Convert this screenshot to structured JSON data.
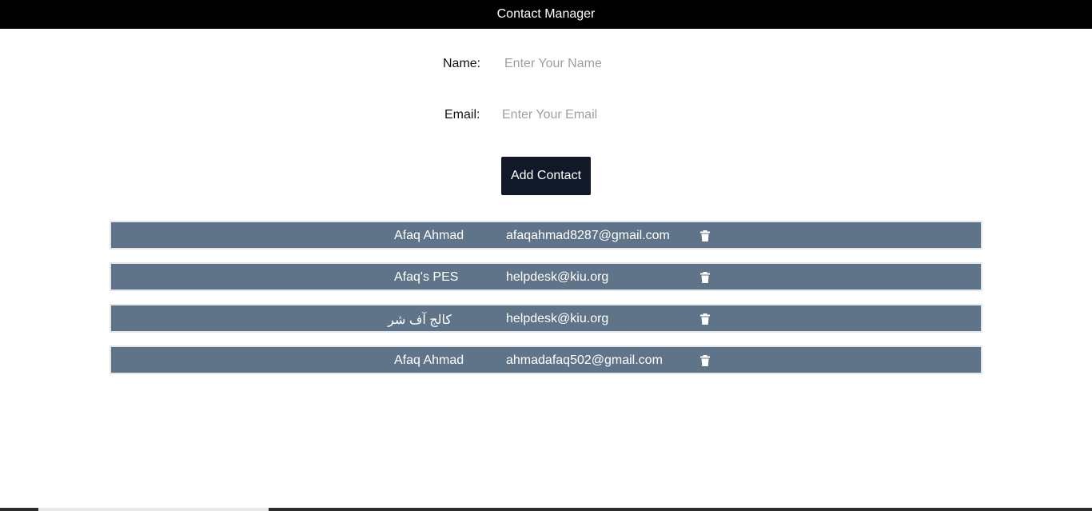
{
  "header": {
    "title": "Contact Manager"
  },
  "form": {
    "name_label": "Name:",
    "name_placeholder": "Enter Your Name",
    "name_value": "",
    "email_label": "Email:",
    "email_placeholder": "Enter Your Email",
    "email_value": "",
    "submit_label": "Add Contact"
  },
  "contacts": [
    {
      "name": "Afaq Ahmad",
      "email": "afaqahmad8287@gmail.com",
      "delete_icon": "trash-icon"
    },
    {
      "name": "Afaq's PES",
      "email": "helpdesk@kiu.org",
      "delete_icon": "trash-icon"
    },
    {
      "name": "کالج آف شر",
      "email": "helpdesk@kiu.org",
      "delete_icon": "trash-icon"
    },
    {
      "name": "Afaq Ahmad",
      "email": "ahmadafaq502@gmail.com",
      "delete_icon": "trash-icon"
    }
  ],
  "colors": {
    "header_bg": "#000000",
    "button_bg": "#111827",
    "row_bg": "#607489",
    "row_border": "#e2e6ea"
  }
}
